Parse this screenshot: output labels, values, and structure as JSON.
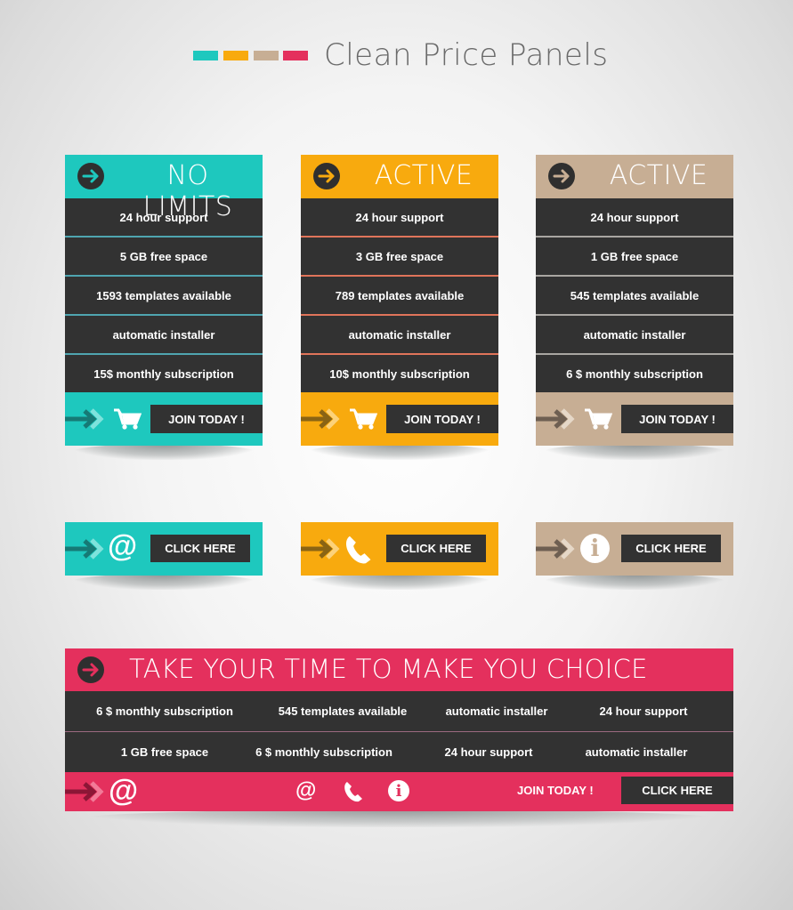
{
  "header": {
    "title": "Clean Price Panels",
    "swatches": [
      "#1ec8be",
      "#f8aa0e",
      "#c7ae94",
      "#e4305d"
    ]
  },
  "colors": {
    "teal": "#1ec8be",
    "orange": "#f8aa0e",
    "tan": "#c7ae94",
    "pink": "#e4305d",
    "dark": "#323232"
  },
  "pricing_panels": [
    {
      "title": "NO LIMITS",
      "color": "#1ec8be",
      "features": [
        "24 hour support",
        "5 GB free space",
        "1593 templates available",
        "automatic installer",
        "15$ monthly subscription"
      ],
      "icon": "cart-icon",
      "button_label": "JOIN TODAY !"
    },
    {
      "title": "ACTIVE",
      "color": "#f8aa0e",
      "features": [
        "24 hour support",
        "3 GB free space",
        "789 templates available",
        "automatic installer",
        "10$ monthly subscription"
      ],
      "icon": "cart-icon",
      "button_label": "JOIN TODAY !"
    },
    {
      "title": "ACTIVE",
      "color": "#c7ae94",
      "features": [
        "24 hour support",
        "1 GB free space",
        "545 templates available",
        "automatic installer",
        "6 $ monthly subscription"
      ],
      "icon": "cart-icon",
      "button_label": "JOIN TODAY !"
    }
  ],
  "click_panels": [
    {
      "color": "#1ec8be",
      "icon": "at-sign-icon",
      "icon_glyph": "@",
      "button_label": "CLICK HERE"
    },
    {
      "color": "#f8aa0e",
      "icon": "phone-icon",
      "icon_glyph": "",
      "button_label": "CLICK HERE"
    },
    {
      "color": "#c7ae94",
      "icon": "info-icon",
      "icon_glyph": "i",
      "button_label": "CLICK HERE"
    }
  ],
  "wide_panel": {
    "title": "TAKE YOUR TIME TO MAKE YOU CHOICE",
    "color": "#e4305d",
    "rows": [
      [
        "6 $ monthly subscription",
        "545 templates available",
        "automatic installer",
        "24 hour support"
      ],
      [
        "1 GB free space",
        "6 $ monthly subscription",
        "24 hour support",
        "automatic installer"
      ]
    ],
    "footer": {
      "left_icon_glyph": "@",
      "icons": [
        "at-sign-icon",
        "phone-icon",
        "info-icon"
      ],
      "at_glyph": "@",
      "info_glyph": "i",
      "join_label": "JOIN TODAY !",
      "button_label": "CLICK HERE"
    }
  }
}
